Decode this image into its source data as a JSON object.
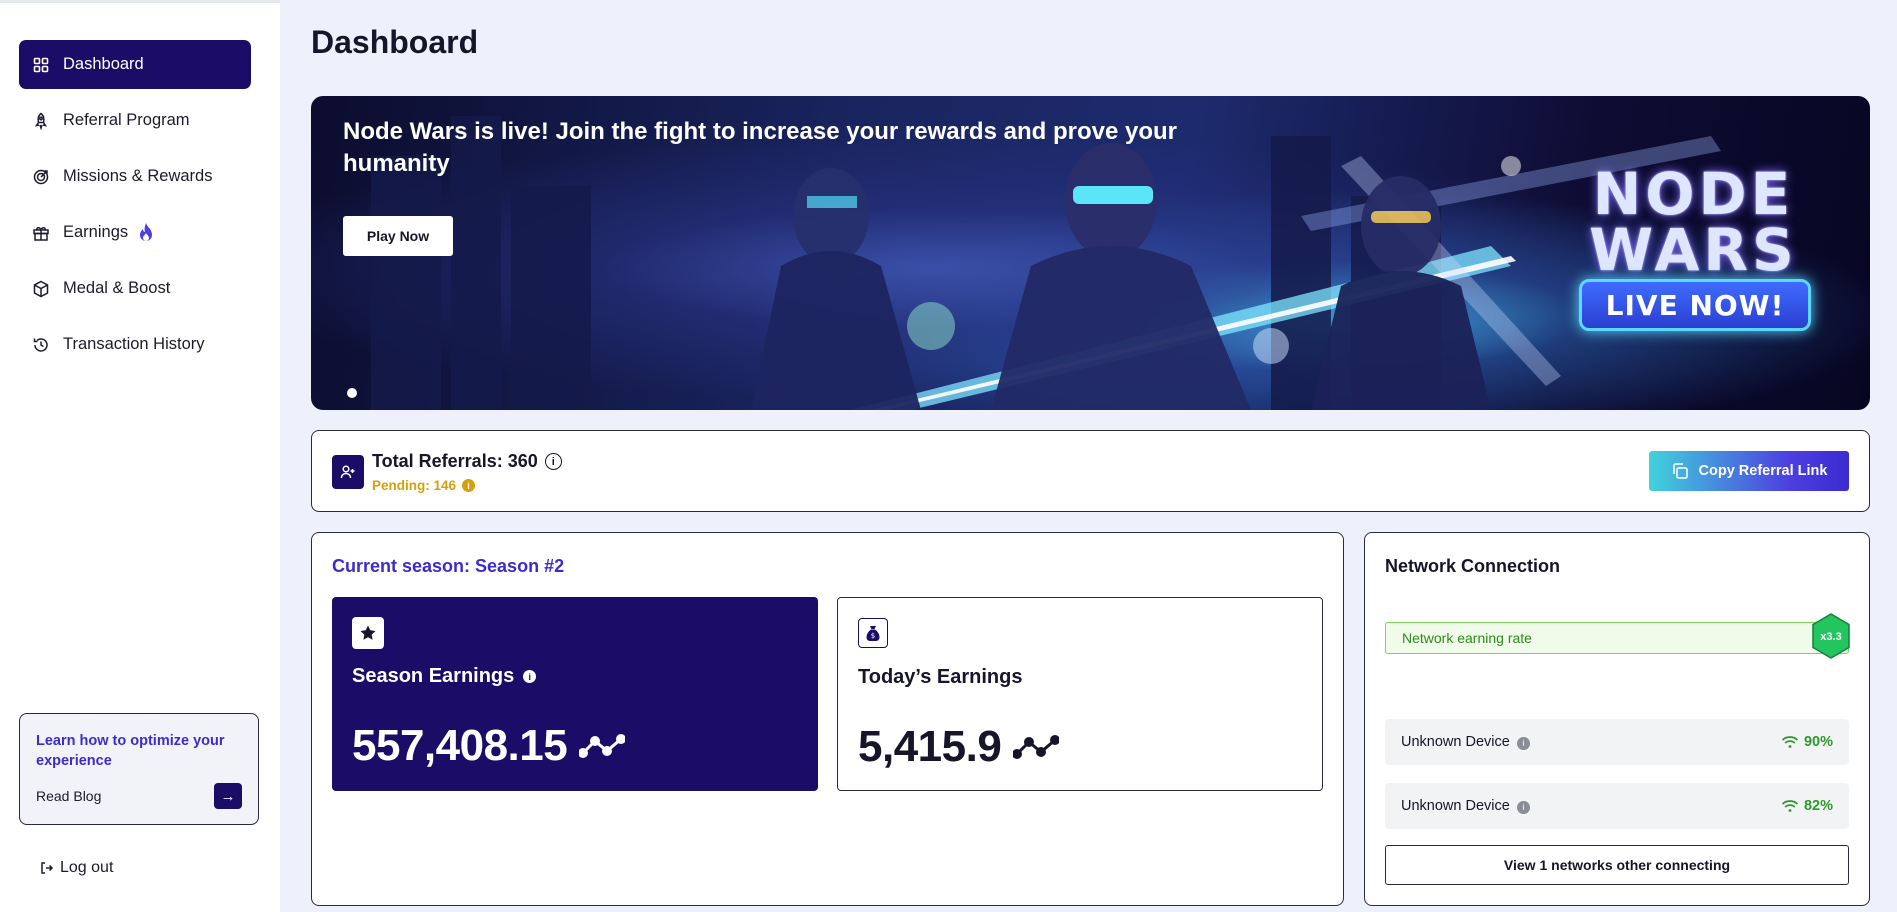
{
  "sidebar": {
    "items": [
      {
        "label": "Dashboard",
        "icon": "grid-icon",
        "active": true
      },
      {
        "label": "Referral Program",
        "icon": "rocket-icon"
      },
      {
        "label": "Missions & Rewards",
        "icon": "target-icon"
      },
      {
        "label": "Earnings",
        "icon": "gift-icon",
        "badge_icon": "flame-icon"
      },
      {
        "label": "Medal & Boost",
        "icon": "cube-icon"
      },
      {
        "label": "Transaction History",
        "icon": "history-icon"
      }
    ],
    "learn": {
      "title": "Learn how to optimize your experience",
      "link": "Read Blog"
    },
    "logout": "Log out"
  },
  "page": {
    "title": "Dashboard"
  },
  "banner": {
    "headline": "Node Wars is live! Join the fight to increase your rewards and prove your humanity",
    "button": "Play Now",
    "logo_line1": "NODE",
    "logo_line2": "WARS",
    "live_label": "LIVE NOW!"
  },
  "referral": {
    "total": "Total Referrals: 360",
    "pending": "Pending: 146",
    "copy_button": "Copy Referral Link"
  },
  "season": {
    "title": "Current season: Season #2",
    "season_earnings_label": "Season Earnings",
    "season_earnings_value": "557,408.15",
    "today_label": "Today’s Earnings",
    "today_value": "5,415.9"
  },
  "network": {
    "title": "Network Connection",
    "rate_label": "Network earning rate",
    "multiplier": "x3.3",
    "devices": [
      {
        "name": "Unknown Device",
        "signal": "90%"
      },
      {
        "name": "Unknown Device",
        "signal": "82%"
      }
    ],
    "view_button": "View 1 networks other connecting"
  },
  "colors": {
    "brand": "#1b0d67",
    "accent": "#3b2bd0",
    "pending": "#d4a10c",
    "success": "#2f9a2a"
  }
}
